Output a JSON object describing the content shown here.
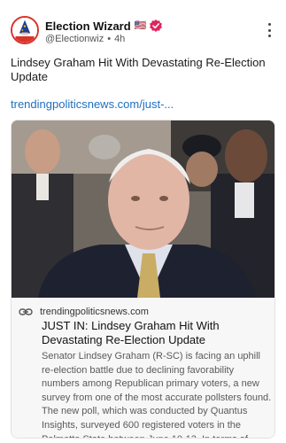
{
  "author": {
    "display_name": "Election Wizard",
    "flag": "🇺🇸",
    "handle": "@Electionwiz",
    "separator": "•",
    "time": "4h",
    "avatar_icon": "wizard-avatar-icon",
    "verified_icon": "verified-badge-icon",
    "verified_color": "#e0245e"
  },
  "post": {
    "text": "Lindsey Graham Hit With Devastating Re-Election Update",
    "link_text": "trendingpoliticsnews.com/just-..."
  },
  "embed": {
    "image_alt_icon": "news-photo",
    "domain": "trendingpoliticsnews.com",
    "title": "JUST IN: Lindsey Graham Hit With Devastating Re-Election Update",
    "description": "Senator Lindsey Graham (R-SC) is facing an uphill re-election battle due to declining favorability numbers among Republican primary voters, a new survey from one of the most accurate pollsters found. The new poll, which was conducted by Quantus Insights, surveyed 600 registered voters in the Palmetto State between June 10-13. In terms of overall approval [...]"
  },
  "colors": {
    "link": "#1f6fbf",
    "accent_red": "#d9342b"
  }
}
